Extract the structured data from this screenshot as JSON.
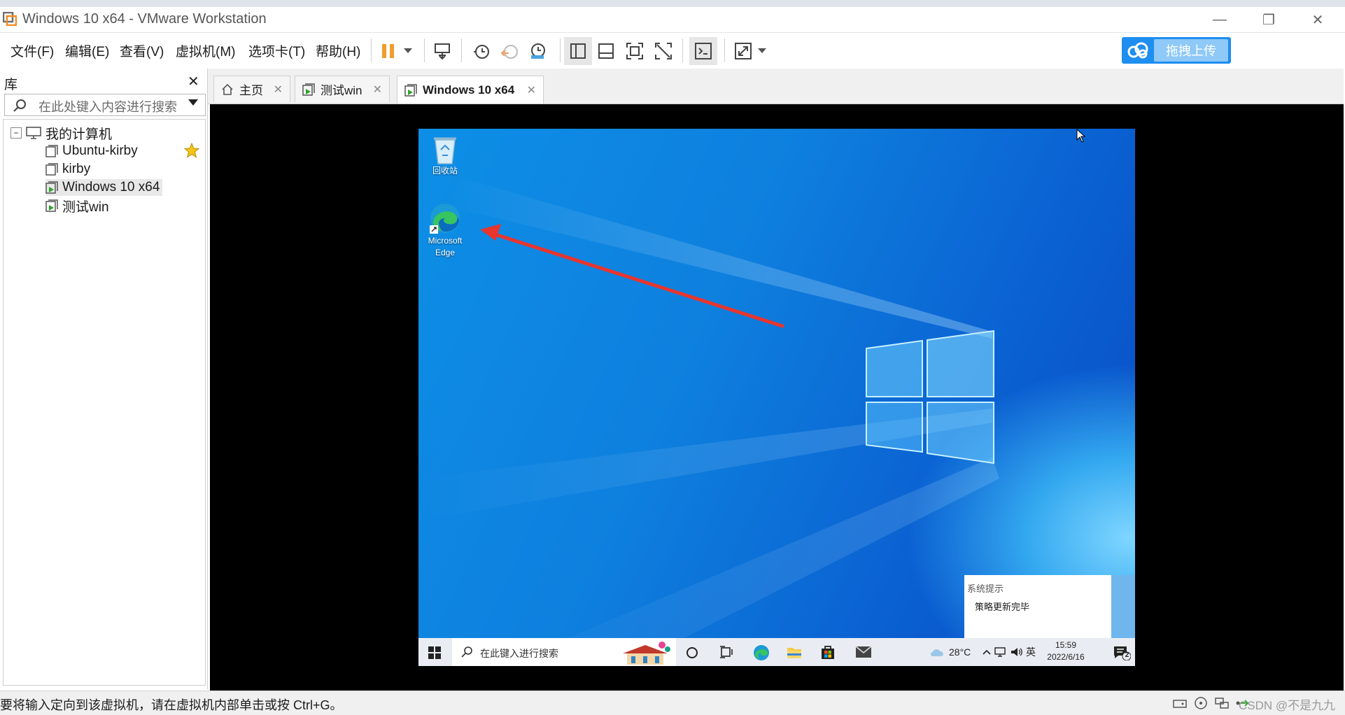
{
  "window": {
    "title": "Windows 10 x64 - VMware Workstation"
  },
  "menu": [
    "文件(F)",
    "编辑(E)",
    "查看(V)",
    "虚拟机(M)",
    "选项卡(T)",
    "帮助(H)"
  ],
  "upload_button": "拖拽上传",
  "library": {
    "header": "库",
    "search_placeholder": "在此处键入内容进行搜索",
    "root": "我的计算机",
    "vms": [
      "Ubuntu-kirby",
      "kirby",
      "Windows 10 x64",
      "测试win"
    ]
  },
  "tabs": [
    "主页",
    "测试win",
    "Windows 10 x64"
  ],
  "guest": {
    "icons": {
      "recycle_bin": "回收站",
      "edge_line1": "Microsoft",
      "edge_line2": "Edge"
    },
    "notification": {
      "title": "系统提示",
      "body": "策略更新完毕"
    },
    "taskbar": {
      "search_placeholder": "在此键入进行搜索",
      "weather": "28°C",
      "ime": "英",
      "time": "15:59",
      "date": "2022/6/16",
      "notification_count": "2"
    }
  },
  "status_bar": {
    "message": "要将输入定向到该虚拟机，请在虚拟机内部单击或按 Ctrl+G。",
    "watermark": "CSDN @不是九九"
  },
  "colors": {
    "accent": "#1e8ef0",
    "pause": "#f39c2c",
    "arrow": "#e8352e",
    "desktop": "#0e7fde"
  }
}
